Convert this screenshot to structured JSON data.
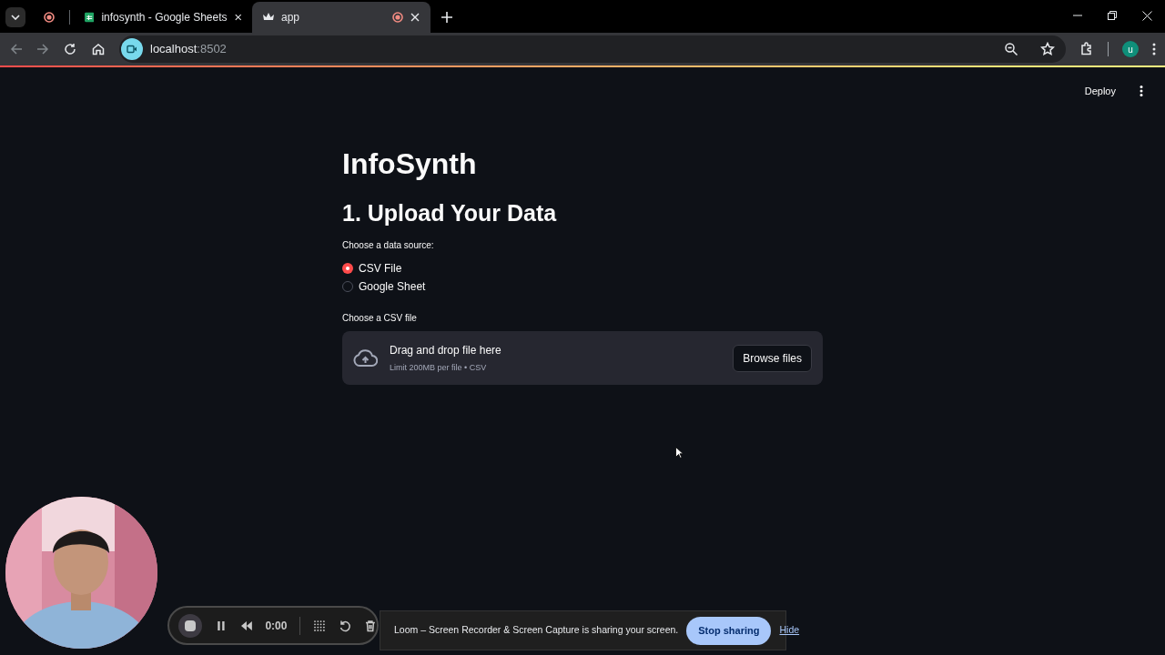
{
  "browser": {
    "tabs": [
      {
        "kind": "pinned",
        "recording": true,
        "selected": false
      },
      {
        "kind": "sheets",
        "title": "infosynth - Google Sheets",
        "recording": false,
        "selected": false
      },
      {
        "kind": "app",
        "title": "app",
        "recording": true,
        "selected": true
      }
    ],
    "address": {
      "host": "localhost",
      "port": ":8502"
    },
    "profile_initial": "u"
  },
  "app": {
    "deploy": "Deploy",
    "title": "InfoSynth",
    "section": "1. Upload Your Data",
    "source_label": "Choose a data source:",
    "options": [
      {
        "label": "CSV File",
        "selected": true
      },
      {
        "label": "Google Sheet",
        "selected": false
      }
    ],
    "uploader_label": "Choose a CSV file",
    "drop_text": "Drag and drop file here",
    "limit_text": "Limit 200MB per file • CSV",
    "browse": "Browse files"
  },
  "recorder": {
    "time": "0:00"
  },
  "share_bar": {
    "message": "Loom – Screen Recorder & Screen Capture is sharing your screen.",
    "stop": "Stop sharing",
    "hide": "Hide"
  }
}
